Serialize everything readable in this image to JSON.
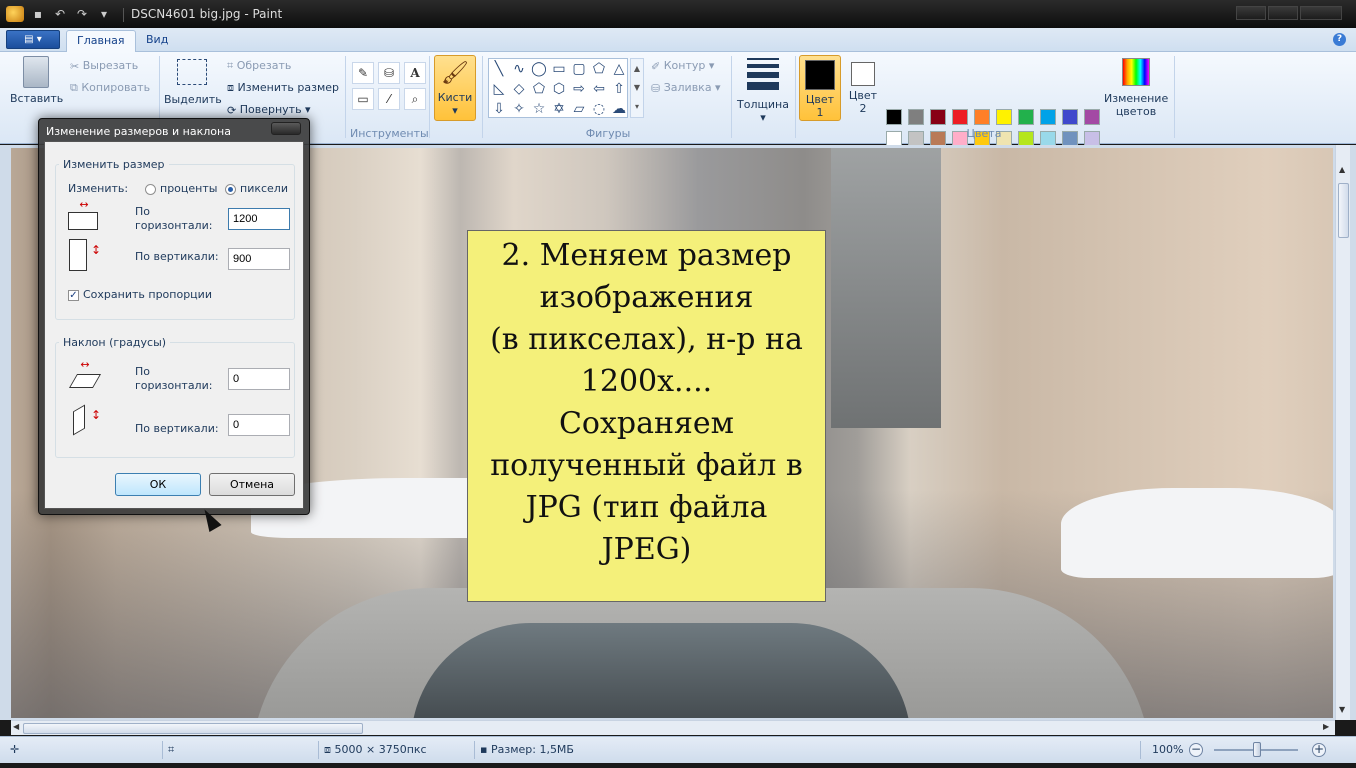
{
  "window": {
    "title": "DSCN4601 big.jpg - Paint"
  },
  "ribbon_tabs": [
    {
      "label": "Главная",
      "active": true
    },
    {
      "label": "Вид",
      "active": false
    }
  ],
  "clipboard": {
    "paste": "Вставить",
    "cut": "Вырезать",
    "copy": "Копировать"
  },
  "image_group": {
    "select": "Выделить",
    "crop": "Обрезать",
    "resize": "Изменить размер",
    "rotate": "Повернуть"
  },
  "tools": {
    "label": "Инструменты"
  },
  "brushes": {
    "label": "Кисти"
  },
  "shapes": {
    "label": "Фигуры",
    "outline": "Контур",
    "fill": "Заливка"
  },
  "size": {
    "label": "Толщина"
  },
  "colors": {
    "label": "Цвета",
    "color1_line1": "Цвет",
    "color1_line2": "1",
    "color2_line1": "Цвет",
    "color2_line2": "2",
    "edit_line1": "Изменение",
    "edit_line2": "цветов",
    "color1": "#000000",
    "color2": "#ffffff",
    "palette": [
      "#000000",
      "#7f7f7f",
      "#880015",
      "#ed1c24",
      "#ff7f27",
      "#fff200",
      "#22b14c",
      "#00a2e8",
      "#3f48cc",
      "#a349a4",
      "#ffffff",
      "#c3c3c3",
      "#b97a57",
      "#ffaec9",
      "#ffc90e",
      "#efe4b0",
      "#b5e61d",
      "#99d9ea",
      "#7092be",
      "#c8bfe7"
    ]
  },
  "dialog": {
    "title": "Изменение размеров и наклона",
    "resize_group": "Изменить размер",
    "by_label": "Изменить:",
    "percent_label": "проценты",
    "pixels_label": "пиксели",
    "mode": "pixels",
    "horizontal_line1": "По",
    "horizontal_line2": "горизонтали:",
    "horizontal_value": "1200",
    "vertical_label": "По вертикали:",
    "vertical_value": "900",
    "keep_ratio_label": "Сохранить пропорции",
    "keep_ratio": true,
    "skew_group": "Наклон (градусы)",
    "skew_h_line1": "По",
    "skew_h_line2": "горизонтали:",
    "skew_h_value": "0",
    "skew_v_label": "По вертикали:",
    "skew_v_value": "0",
    "ok": "ОК",
    "cancel": "Отмена"
  },
  "note": {
    "lines": [
      "2. Меняем размер",
      "изображения",
      "(в пикселах), н-р на",
      "1200х....",
      "Сохраняем",
      "полученный файл в",
      "JPG (тип файла",
      "JPEG)"
    ]
  },
  "statusbar": {
    "dimensions": "5000 × 3750пкс",
    "file_size": "Размер: 1,5МБ",
    "zoom": "100%",
    "zoom_out": "−",
    "zoom_in": "+"
  }
}
